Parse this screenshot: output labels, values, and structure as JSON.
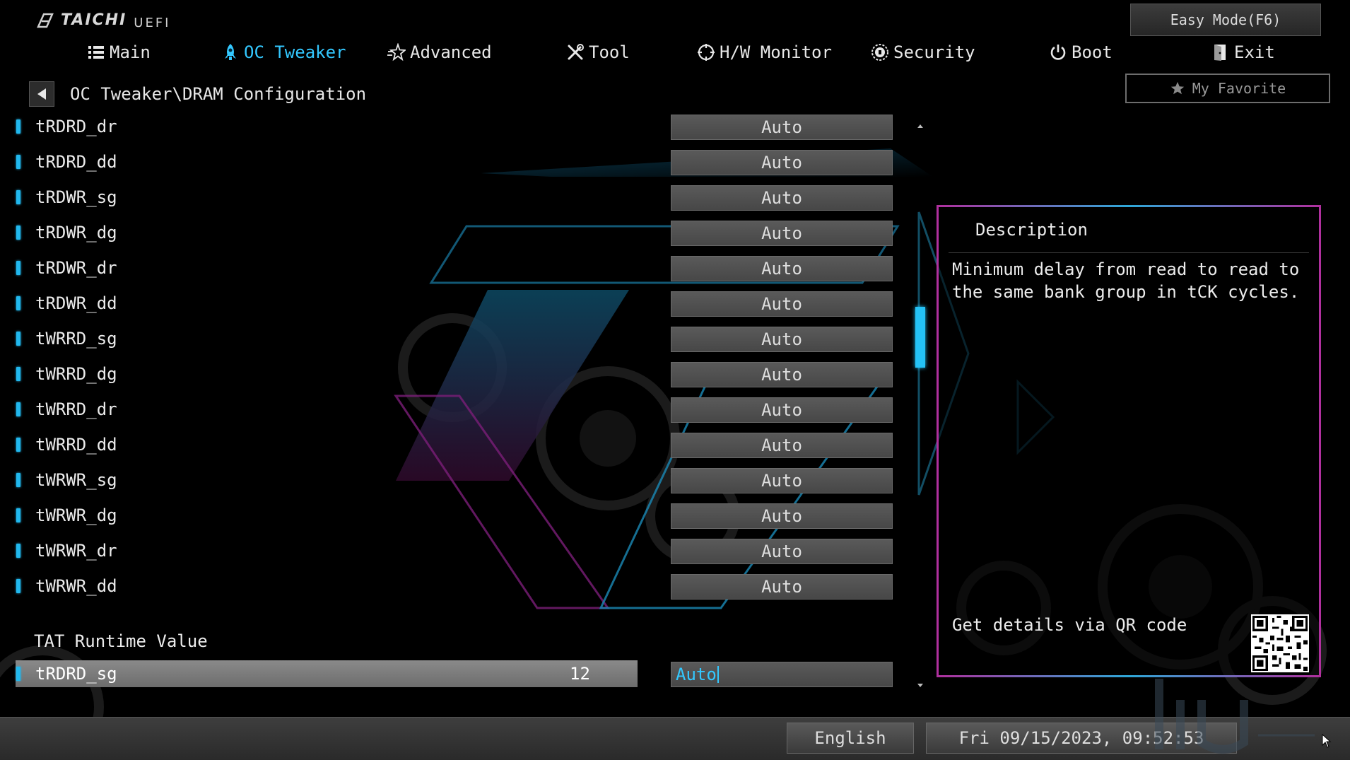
{
  "header": {
    "brand": "TAICHI",
    "sub": "UEFI",
    "easy_mode": "Easy Mode(F6)",
    "favorite": "My Favorite"
  },
  "tabs": [
    {
      "label": "Main",
      "icon": "list-icon"
    },
    {
      "label": "OC Tweaker",
      "icon": "rocket-icon",
      "active": true
    },
    {
      "label": "Advanced",
      "icon": "star-icon"
    },
    {
      "label": "Tool",
      "icon": "tools-icon"
    },
    {
      "label": "H/W Monitor",
      "icon": "monitor-icon"
    },
    {
      "label": "Security",
      "icon": "shield-icon"
    },
    {
      "label": "Boot",
      "icon": "power-icon"
    },
    {
      "label": "Exit",
      "icon": "exit-icon"
    }
  ],
  "breadcrumb": "OC Tweaker\\DRAM Configuration",
  "items": [
    {
      "label": "tRDRD_dr",
      "value": "Auto"
    },
    {
      "label": "tRDRD_dd",
      "value": "Auto"
    },
    {
      "label": "tRDWR_sg",
      "value": "Auto"
    },
    {
      "label": "tRDWR_dg",
      "value": "Auto"
    },
    {
      "label": "tRDWR_dr",
      "value": "Auto"
    },
    {
      "label": "tRDWR_dd",
      "value": "Auto"
    },
    {
      "label": "tWRRD_sg",
      "value": "Auto"
    },
    {
      "label": "tWRRD_dg",
      "value": "Auto"
    },
    {
      "label": "tWRRD_dr",
      "value": "Auto"
    },
    {
      "label": "tWRRD_dd",
      "value": "Auto"
    },
    {
      "label": "tWRWR_sg",
      "value": "Auto"
    },
    {
      "label": "tWRWR_dg",
      "value": "Auto"
    },
    {
      "label": "tWRWR_dr",
      "value": "Auto"
    },
    {
      "label": "tWRWR_dd",
      "value": "Auto"
    }
  ],
  "section_label": "TAT Runtime Value",
  "selected": {
    "label": "tRDRD_sg",
    "runtime": "12",
    "value": "Auto"
  },
  "description": {
    "title": "Description",
    "text": "Minimum delay from read to read to the same bank group in tCK cycles.",
    "qr_text": "Get details via QR code"
  },
  "footer": {
    "language": "English",
    "datetime": "Fri 09/15/2023, 09:52:53"
  },
  "colors": {
    "accent": "#33c8ff",
    "frame_pink": "#b0309e"
  }
}
